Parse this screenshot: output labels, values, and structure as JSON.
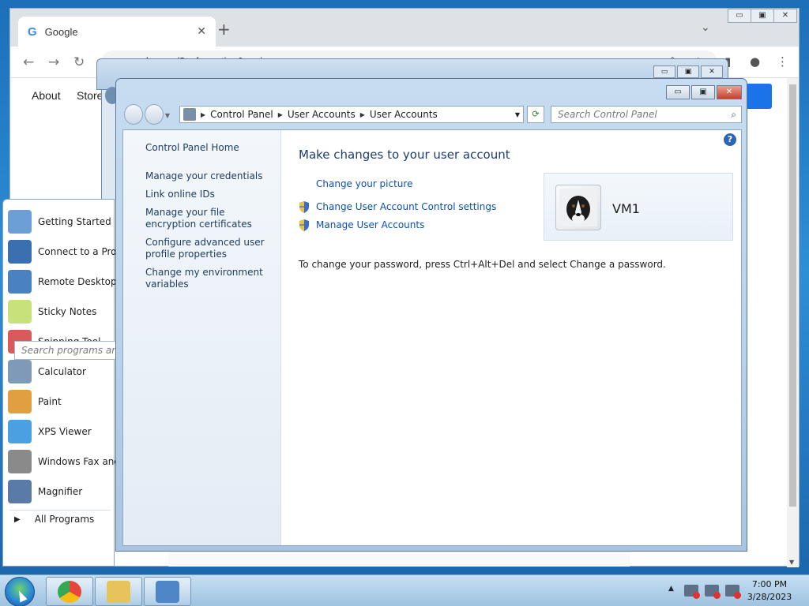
{
  "chrome": {
    "tab_title": "Google",
    "tab_logo": "G",
    "close_tab": "✕",
    "new_tab": "+",
    "tab_search": "⌄",
    "window_controls": [
      "▭",
      "▣",
      "✕"
    ],
    "back": "←",
    "forward": "→",
    "reload": "↻",
    "url": "google.com/?safe=active&ssui=on",
    "share": "⇪",
    "bookmark": "☆",
    "side_panel": "▮",
    "profile": "●",
    "menu": "⋮",
    "page_links": [
      "About",
      "Store"
    ]
  },
  "bg_explorer": {
    "window_controls": [
      "▭",
      "▣",
      "✕"
    ]
  },
  "start_menu": {
    "items": [
      {
        "label": "Getting Started",
        "icon": "getting-started-icon",
        "color": "#6b9fd6"
      },
      {
        "label": "Connect to a Proj",
        "icon": "projector-icon",
        "color": "#3a6fb0"
      },
      {
        "label": "Remote Desktop C",
        "icon": "remote-desktop-icon",
        "color": "#4a82c0"
      },
      {
        "label": "Sticky Notes",
        "icon": "sticky-notes-icon",
        "color": "#c7e27a"
      },
      {
        "label": "Snipping Tool",
        "icon": "scissors-icon",
        "color": "#d85a5a"
      },
      {
        "label": "Calculator",
        "icon": "calculator-icon",
        "color": "#7f9ab8"
      },
      {
        "label": "Paint",
        "icon": "paint-icon",
        "color": "#e0a040"
      },
      {
        "label": "XPS Viewer",
        "icon": "xps-viewer-icon",
        "color": "#4aa0e0"
      },
      {
        "label": "Windows Fax and",
        "icon": "fax-icon",
        "color": "#8a8a8a"
      },
      {
        "label": "Magnifier",
        "icon": "magnifier-icon",
        "color": "#5a7aa8"
      }
    ],
    "all_programs": "All Programs",
    "search_placeholder": "Search programs and files"
  },
  "control_panel": {
    "window_controls": [
      "▭",
      "▣",
      "✕"
    ],
    "breadcrumb": [
      "Control Panel",
      "User Accounts",
      "User Accounts"
    ],
    "search_placeholder": "Search Control Panel",
    "refresh": "⟳",
    "sidebar": [
      "Control Panel Home",
      "Manage your credentials",
      "Link online IDs",
      "Manage your file encryption certificates",
      "Configure advanced user profile properties",
      "Change my environment variables"
    ],
    "heading": "Make changes to your user account",
    "tasks": [
      "Change your picture",
      "Change User Account Control settings",
      "Manage User Accounts"
    ],
    "password_note": "To change your password, press Ctrl+Alt+Del and select Change a password.",
    "username": "VM1",
    "help": "?"
  },
  "taskbar": {
    "time": "7:00 PM",
    "date": "3/28/2023",
    "tray_arrow": "▲",
    "apps": [
      {
        "name": "chrome-icon",
        "color": "#e8453c"
      },
      {
        "name": "explorer-folder-icon",
        "color": "#e8c35a"
      },
      {
        "name": "control-panel-icon",
        "color": "#4e86c8"
      }
    ]
  },
  "colors": {
    "link": "#0b4fb0",
    "heading": "#1e3b71",
    "close_button": "#c8402c"
  }
}
